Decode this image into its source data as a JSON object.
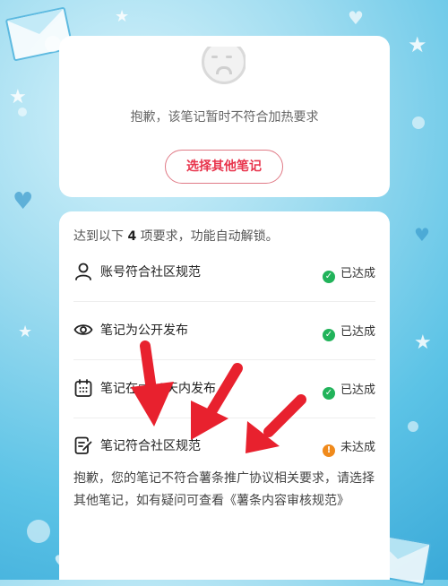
{
  "notice": {
    "text": "抱歉，该笔记暂时不符合加热要求",
    "select_button": "选择其他笔记"
  },
  "requirements": {
    "intro_prefix": "达到以下",
    "intro_count": "4",
    "intro_suffix": "项要求，功能自动解锁。",
    "items": [
      {
        "label": "账号符合社区规范",
        "status": "已达成",
        "icon": "person-icon"
      },
      {
        "label": "笔记为公开发布",
        "status": "已达成",
        "icon": "eye-icon"
      },
      {
        "label": "笔记在□90天内发布",
        "status": "已达成",
        "icon": "calendar-icon"
      },
      {
        "label": "笔记符合社区规范",
        "status": "未达成",
        "icon": "note-edit-icon"
      }
    ],
    "failure_message": "抱歉，您的笔记不符合薯条推广协议相关要求，请选择其他笔记，如有疑问可查看《薯条内容审核规范》"
  },
  "colors": {
    "accent": "#e8344c",
    "success": "#21b35a",
    "warning": "#f08a1b",
    "annotation_arrow": "#e8212e"
  }
}
